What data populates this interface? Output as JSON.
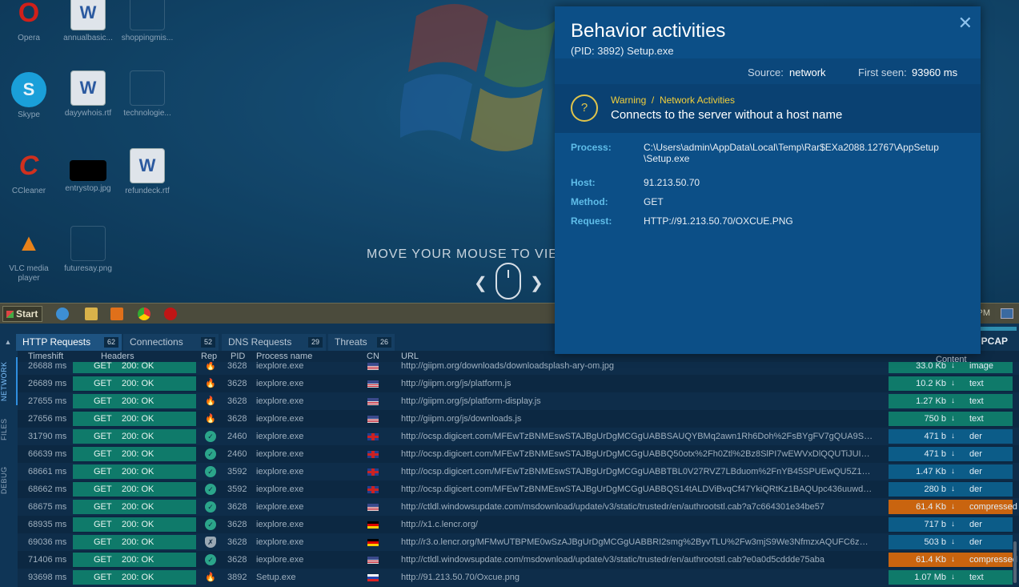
{
  "desktop": {
    "icons": [
      {
        "label": "Opera",
        "glyph": "O",
        "kind": "opera"
      },
      {
        "label": "annualbasic...",
        "glyph": "W",
        "kind": "doc"
      },
      {
        "label": "shoppingmis...",
        "glyph": "",
        "kind": "blank"
      },
      {
        "label": "Skype",
        "glyph": "S",
        "kind": "skype"
      },
      {
        "label": "dayywhois.rtf",
        "glyph": "W",
        "kind": "doc"
      },
      {
        "label": "technologie...",
        "glyph": "",
        "kind": "blank"
      },
      {
        "label": "CCleaner",
        "glyph": "C",
        "kind": "ccleaner"
      },
      {
        "label": "entrystop.jpg",
        "glyph": "",
        "kind": "black"
      },
      {
        "label": "refundeck.rtf",
        "glyph": "W",
        "kind": "doc"
      },
      {
        "label": "VLC media player",
        "glyph": "▲",
        "kind": "vlc"
      },
      {
        "label": "futuresay.png",
        "glyph": "",
        "kind": "blank"
      }
    ],
    "hint_text": "MOVE YOUR MOUSE TO VIEW"
  },
  "taskbar": {
    "start_label": "Start",
    "clock": "PM"
  },
  "tabs": [
    {
      "label": "HTTP Requests",
      "count": "62",
      "active": true
    },
    {
      "label": "Connections",
      "count": "52",
      "active": false
    },
    {
      "label": "DNS Requests",
      "count": "29",
      "active": false
    },
    {
      "label": "Threats",
      "count": "26",
      "active": false
    }
  ],
  "pcap_label": "PCAP",
  "rail": [
    {
      "label": "NETWORK",
      "active": true
    },
    {
      "label": "FILES",
      "active": false
    },
    {
      "label": "DEBUG",
      "active": false
    }
  ],
  "columns": {
    "timeshift": "Timeshift",
    "headers": "Headers",
    "rep": "Rep",
    "pid": "PID",
    "process": "Process name",
    "cn": "CN",
    "url": "URL",
    "content": "Content"
  },
  "rows": [
    {
      "time": "26688 ms",
      "method": "GET",
      "status": "200: OK",
      "rep": "danger",
      "pid": "3628",
      "process": "iexplore.exe",
      "cn": "us",
      "url": "http://giipm.org/downloads/downloadsplash-ary-om.jpg",
      "size": "33.0 Kb",
      "ctype": "image"
    },
    {
      "time": "26689 ms",
      "method": "GET",
      "status": "200: OK",
      "rep": "danger",
      "pid": "3628",
      "process": "iexplore.exe",
      "cn": "us",
      "url": "http://giipm.org/js/platform.js",
      "size": "10.2 Kb",
      "ctype": "text"
    },
    {
      "time": "27655 ms",
      "method": "GET",
      "status": "200: OK",
      "rep": "danger",
      "pid": "3628",
      "process": "iexplore.exe",
      "cn": "us",
      "url": "http://giipm.org/js/platform-display.js",
      "size": "1.27 Kb",
      "ctype": "text"
    },
    {
      "time": "27656 ms",
      "method": "GET",
      "status": "200: OK",
      "rep": "danger",
      "pid": "3628",
      "process": "iexplore.exe",
      "cn": "us",
      "url": "http://giipm.org/js/downloads.js",
      "size": "750 b",
      "ctype": "text"
    },
    {
      "time": "31790 ms",
      "method": "GET",
      "status": "200: OK",
      "rep": "ok",
      "pid": "2460",
      "process": "iexplore.exe",
      "cn": "gb",
      "url": "http://ocsp.digicert.com/MFEwTzBNMEswSTAJBgUrDgMCGgUABBSAUQYBMq2awn1Rh6Doh%2FsBYgFV7gQUA9SQNV...",
      "size": "471 b",
      "ctype": "der"
    },
    {
      "time": "66639 ms",
      "method": "GET",
      "status": "200: OK",
      "rep": "ok",
      "pid": "2460",
      "process": "iexplore.exe",
      "cn": "gb",
      "url": "http://ocsp.digicert.com/MFEwTzBNMEswSTAJBgUrDgMCGgUABBQ50otx%2Fh0Ztl%2Bz8SlPI7wEWVxDlQQUTiJUIBiV5...",
      "size": "471 b",
      "ctype": "der"
    },
    {
      "time": "68661 ms",
      "method": "GET",
      "status": "200: OK",
      "rep": "ok",
      "pid": "3592",
      "process": "iexplore.exe",
      "cn": "gb",
      "url": "http://ocsp.digicert.com/MFEwTzBNMEswSTAJBgUrDgMCGgUABBTBL0V27RVZ7LBduom%2FnYB45SPUEwQU5Z1ZMI...",
      "size": "1.47 Kb",
      "ctype": "der"
    },
    {
      "time": "68662 ms",
      "method": "GET",
      "status": "200: OK",
      "rep": "ok",
      "pid": "3592",
      "process": "iexplore.exe",
      "cn": "gb",
      "url": "http://ocsp.digicert.com/MFEwTzBNMEswSTAJBgUrDgMCGgUABBQS14tALDViBvqCf47YkiQRtKz1BAQUpc436uuwdQ6...",
      "size": "280 b",
      "ctype": "der"
    },
    {
      "time": "68675 ms",
      "method": "GET",
      "status": "200: OK",
      "rep": "ok",
      "pid": "3628",
      "process": "iexplore.exe",
      "cn": "us",
      "url": "http://ctldl.windowsupdate.com/msdownload/update/v3/static/trustedr/en/authrootstl.cab?a7c664301e34be57",
      "size": "61.4 Kb",
      "ctype": "compressed"
    },
    {
      "time": "68935 ms",
      "method": "GET",
      "status": "200: OK",
      "rep": "ok",
      "pid": "3628",
      "process": "iexplore.exe",
      "cn": "de",
      "url": "http://x1.c.lencr.org/",
      "size": "717 b",
      "ctype": "der"
    },
    {
      "time": "69036 ms",
      "method": "GET",
      "status": "200: OK",
      "rep": "shield",
      "pid": "3628",
      "process": "iexplore.exe",
      "cn": "de",
      "url": "http://r3.o.lencr.org/MFMwUTBPME0wSzAJBgUrDgMCGgUABBRI2smg%2ByvTLU%2Fw3mjS9We3NfmzxAQUFC6zF7dY...",
      "size": "503 b",
      "ctype": "der"
    },
    {
      "time": "71406 ms",
      "method": "GET",
      "status": "200: OK",
      "rep": "ok",
      "pid": "3628",
      "process": "iexplore.exe",
      "cn": "us",
      "url": "http://ctldl.windowsupdate.com/msdownload/update/v3/static/trustedr/en/authrootstl.cab?e0a0d5cddde75aba",
      "size": "61.4 Kb",
      "ctype": "compressed"
    },
    {
      "time": "93698 ms",
      "method": "GET",
      "status": "200: OK",
      "rep": "danger",
      "pid": "3892",
      "process": "Setup.exe",
      "cn": "ru",
      "url": "http://91.213.50.70/Oxcue.png",
      "size": "1.07 Mb",
      "ctype": "text"
    }
  ],
  "popup": {
    "title": "Behavior activities",
    "subtitle": "(PID: 3892) Setup.exe",
    "source_label": "Source:",
    "source_value": "network",
    "first_seen_label": "First seen:",
    "first_seen_value": "93960 ms",
    "warning_category": "Warning",
    "warning_separator": "/",
    "warning_subcategory": "Network Activities",
    "warning_desc": "Connects to the server without a host name",
    "details": [
      {
        "key": "Process:",
        "value": "C:\\Users\\admin\\AppData\\Local\\Temp\\Rar$EXa2088.12767\\AppSetup\n\\Setup.exe"
      },
      {
        "key": "Host:",
        "value": "91.213.50.70"
      },
      {
        "key": "Method:",
        "value": "GET"
      },
      {
        "key": "Request:",
        "value": "HTTP://91.213.50.70/OXCUE.PNG"
      }
    ]
  },
  "colors": {
    "accent": "#0c4f87",
    "ok_green": "#0f7a6a",
    "der_blue": "#0c5c88",
    "compressed_orange": "#c9640f",
    "danger": "#e8582f",
    "warning_yellow": "#f2cf3c"
  }
}
